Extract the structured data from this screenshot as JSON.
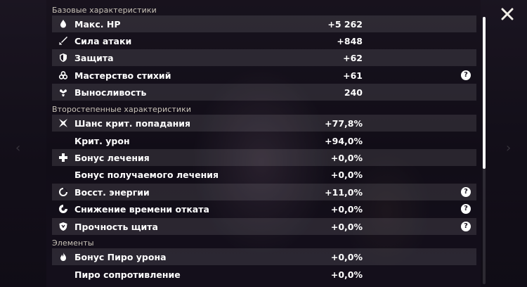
{
  "sections": {
    "base": {
      "title": "Базовые характеристики",
      "rows": [
        {
          "label": "Макс. HP",
          "value": "+5 262",
          "icon": "hp-drop-icon"
        },
        {
          "label": "Сила атаки",
          "value": "+848",
          "icon": "sword-icon"
        },
        {
          "label": "Защита",
          "value": "+62",
          "icon": "shield-icon"
        },
        {
          "label": "Мастерство стихий",
          "value": "+61",
          "icon": "elemental-mastery-icon",
          "help": "?"
        },
        {
          "label": "Выносливость",
          "value": "240",
          "icon": "stamina-icon"
        }
      ]
    },
    "secondary": {
      "title": "Второстепенные характеристики",
      "rows": [
        {
          "label": "Шанс крит. попадания",
          "value": "+77,8%",
          "icon": "crit-star-icon"
        },
        {
          "label": "Крит. урон",
          "value": "+94,0%"
        },
        {
          "label": "Бонус лечения",
          "value": "+0,0%",
          "icon": "healing-cross-icon"
        },
        {
          "label": "Бонус получаемого лечения",
          "value": "+0,0%"
        },
        {
          "label": "Восст. энергии",
          "value": "+11,0%",
          "icon": "energy-recharge-icon",
          "help": "?"
        },
        {
          "label": "Снижение времени отката",
          "value": "+0,0%",
          "icon": "cooldown-icon",
          "help": "?"
        },
        {
          "label": "Прочность щита",
          "value": "+0,0%",
          "icon": "shield-strength-icon",
          "help": "?"
        }
      ]
    },
    "elements": {
      "title": "Элементы",
      "rows": [
        {
          "label": "Бонус Пиро урона",
          "value": "+0,0%",
          "icon": "pyro-icon"
        },
        {
          "label": "Пиро сопротивление",
          "value": "+0,0%"
        }
      ]
    }
  },
  "close": {
    "icon": "close-icon"
  },
  "colors": {
    "row_alt": "#ffffff1a",
    "text": "#ffffff",
    "section_title": "#c9c3b8"
  }
}
